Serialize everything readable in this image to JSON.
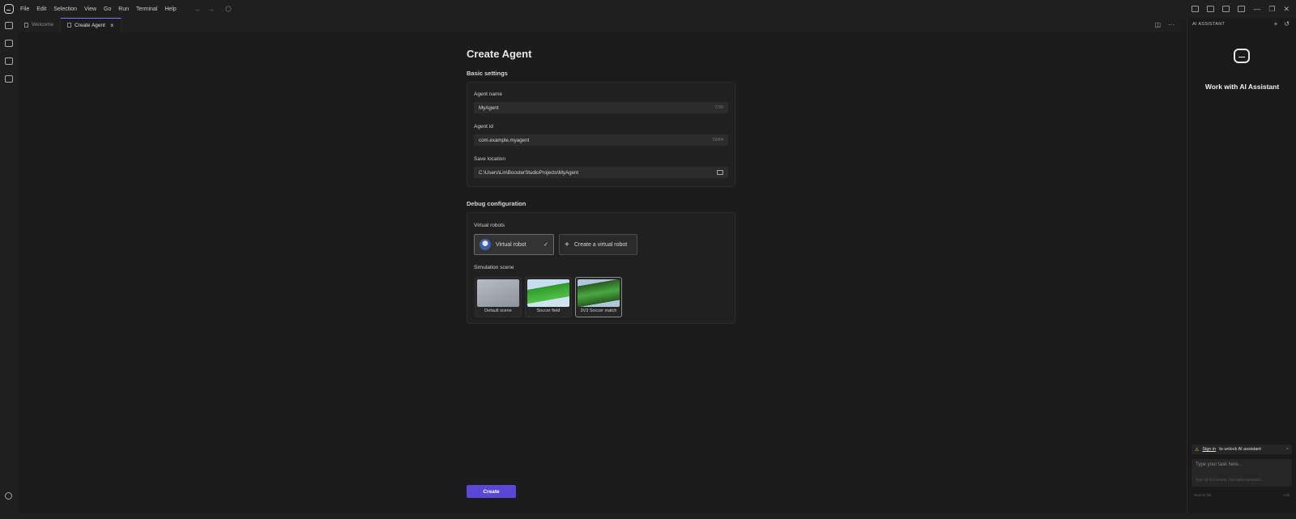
{
  "menu": [
    "File",
    "Edit",
    "Selection",
    "View",
    "Go",
    "Run",
    "Terminal",
    "Help"
  ],
  "tabs": [
    {
      "label": "Welcome"
    },
    {
      "label": "Create Agent"
    }
  ],
  "page": {
    "title": "Create Agent",
    "basic_settings": "Basic settings",
    "agent_name": {
      "label": "Agent name",
      "value": "MyAgent",
      "count": "7/30"
    },
    "agent_id": {
      "label": "Agent id",
      "value": "com.example.myagent",
      "count": "19/64"
    },
    "save_location": {
      "label": "Save location",
      "value": "C:\\Users\\Lin\\BoosterStudioProjects\\MyAgent"
    },
    "debug_configuration": "Debug configuration",
    "virtual_robots": {
      "label": "Virtual robots",
      "selected": "Virtual robot",
      "create": "Create a virtual robot"
    },
    "simulation_scene": {
      "label": "Simulation scene",
      "scenes": [
        "Default scene",
        "Soccer field",
        "3V3 Soccer match"
      ],
      "selected": "3V3 Soccer match"
    },
    "create_button": "Create"
  },
  "ai_panel": {
    "header": "AI ASSISTANT",
    "title": "Work with AI Assistant",
    "signin_link": "Sign in",
    "signin_text": "to unlock AI assistant",
    "task_placeholder": "Type your task here...",
    "task_hint": "Type @ for context, / for work command...",
    "footer_left": "Search file",
    "footer_right": "Ask"
  }
}
